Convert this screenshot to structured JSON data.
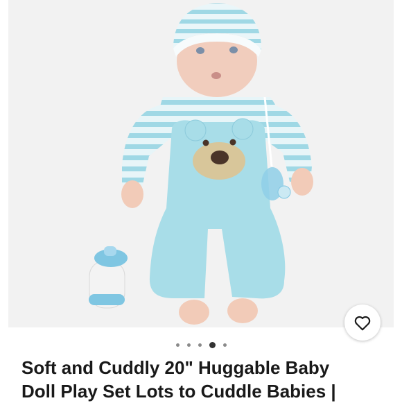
{
  "listing": {
    "title_lines": [
      "Soft and Cuddly 20\" Huggable Baby",
      "Doll Play Set Lots to Cuddle Babies |"
    ]
  },
  "gallery": {
    "image": "baby-doll-photo",
    "image_count": 5,
    "active_index": 3
  },
  "favorite": {
    "icon": "heart-outline-icon"
  },
  "colors": {
    "accent_text": "#191919",
    "gallery_bg": "#f2f2f2",
    "outfit_blue": "#a8dde8"
  }
}
